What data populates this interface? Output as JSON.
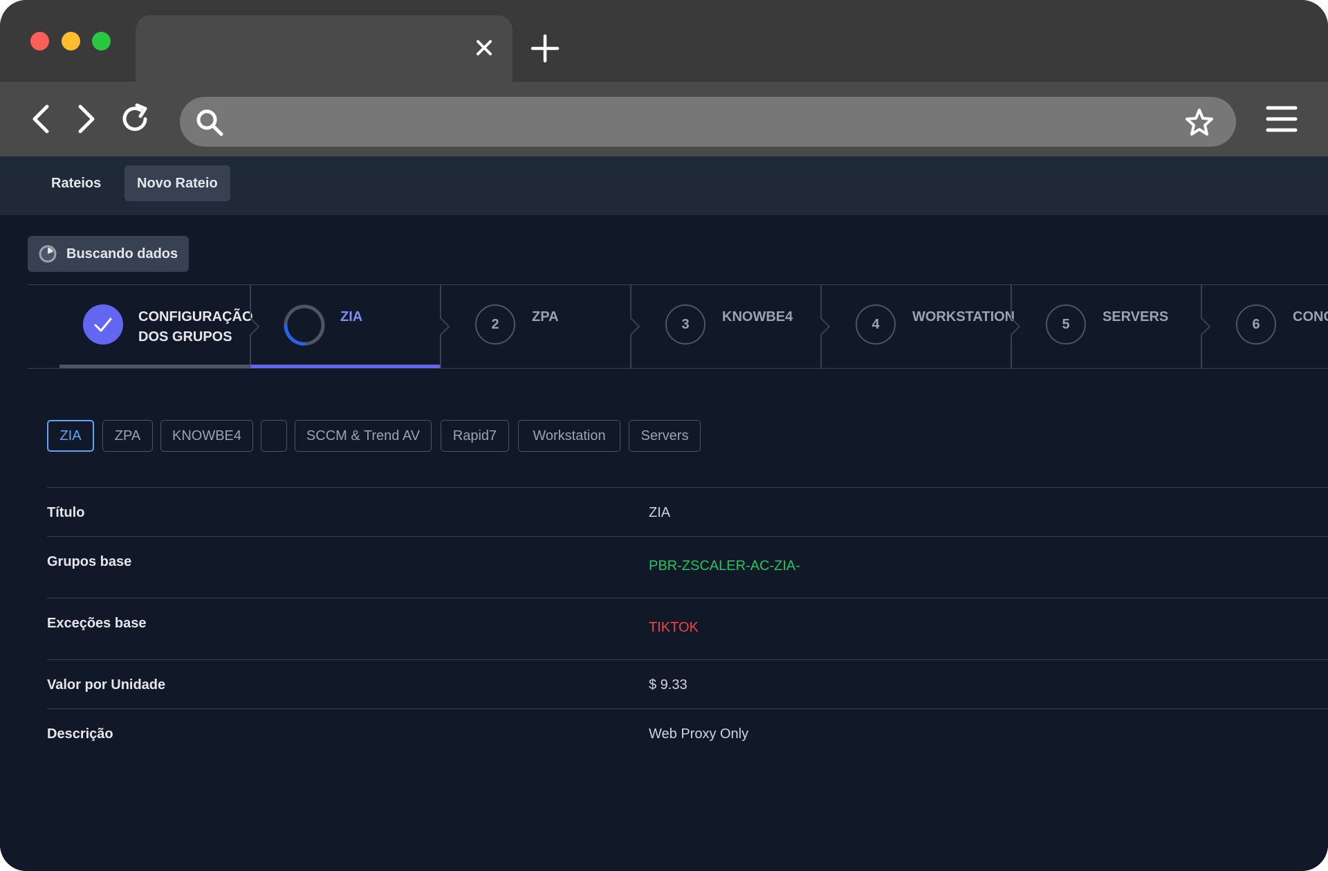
{
  "app": {
    "nav": {
      "rateios": "Rateios",
      "novo_rateio": "Novo Rateio"
    },
    "status": {
      "label": "Buscando dados"
    },
    "stepper": {
      "steps": [
        {
          "label_line1": "CONFIGURAÇÃO",
          "label_line2": "DOS GRUPOS",
          "state": "done"
        },
        {
          "label_line1": "ZIA",
          "state": "current"
        },
        {
          "number": "2",
          "label_line1": "ZPA",
          "state": "pending"
        },
        {
          "number": "3",
          "label_line1": "KNOWBE4",
          "state": "pending"
        },
        {
          "number": "4",
          "label_line1": "WORKSTATION",
          "state": "pending"
        },
        {
          "number": "5",
          "label_line1": "SERVERS",
          "state": "pending"
        },
        {
          "number": "6",
          "label_line1": "CONC",
          "state": "pending"
        }
      ]
    },
    "subtabs": {
      "items": [
        "ZIA",
        "ZPA",
        "KNOWBE4",
        "",
        "SCCM & Trend AV",
        "Rapid7",
        "Workstation",
        "Servers"
      ],
      "active": "ZIA"
    },
    "details": {
      "titulo_label": "Título",
      "titulo_value": "ZIA",
      "grupos_label": "Grupos base",
      "grupos_value": "PBR-ZSCALER-AC-ZIA-",
      "excecoes_label": "Exceções base",
      "excecoes_value": "TIKTOK",
      "valor_label": "Valor por Unidade",
      "valor_value": "$ 9.33",
      "descricao_label": "Descrição",
      "descricao_value": "Web Proxy Only"
    }
  },
  "colors": {
    "accent": "#6366f1",
    "tab_active": "#60a5fa",
    "success": "#22c55e",
    "danger": "#ef4444",
    "background": "#111827"
  }
}
